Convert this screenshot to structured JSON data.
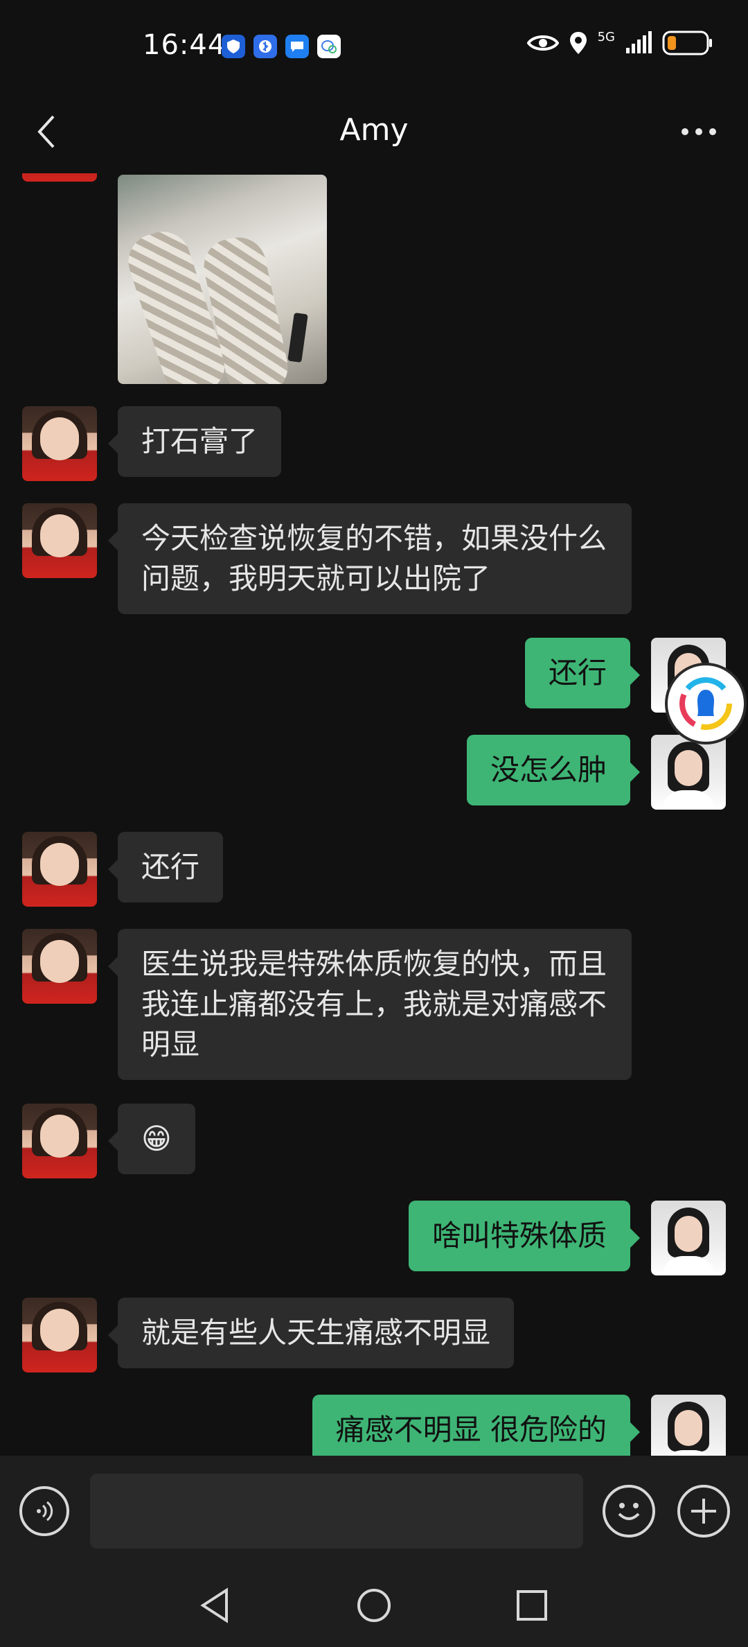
{
  "status_bar": {
    "time": "16:44",
    "network": "5G",
    "icons": [
      "shield-app-icon",
      "bluetooth-app-icon",
      "message-app-icon",
      "chat-app-icon",
      "eye-icon",
      "location-icon",
      "signal-icon",
      "battery-icon"
    ]
  },
  "nav": {
    "title": "Amy",
    "back_icon": "chevron-left-icon",
    "more_icon": "more-dots-icon"
  },
  "messages": [
    {
      "side": "in",
      "type": "image",
      "alt": ""
    },
    {
      "side": "in",
      "type": "text",
      "text": "打石膏了"
    },
    {
      "side": "in",
      "type": "text",
      "text": "今天检查说恢复的不错，如果没什么问题，我明天就可以出院了"
    },
    {
      "side": "out",
      "type": "text",
      "text": "还行"
    },
    {
      "side": "out",
      "type": "text",
      "text": "没怎么肿"
    },
    {
      "side": "in",
      "type": "text",
      "text": "还行"
    },
    {
      "side": "in",
      "type": "text",
      "text": "医生说我是特殊体质恢复的快，而且我连止痛都没有上，我就是对痛感不明显"
    },
    {
      "side": "in",
      "type": "text",
      "text": "😁"
    },
    {
      "side": "out",
      "type": "text",
      "text": "啥叫特殊体质"
    },
    {
      "side": "in",
      "type": "text",
      "text": "就是有些人天生痛感不明显"
    },
    {
      "side": "out",
      "type": "text",
      "text": "痛感不明显 很危险的"
    }
  ],
  "input": {
    "placeholder": "",
    "voice_icon": "voice-icon",
    "emoji_icon": "emoji-icon",
    "plus_icon": "plus-icon"
  },
  "colors": {
    "background": "#111111",
    "incoming_bubble": "#2c2c2c",
    "outgoing_bubble": "#3eb575"
  }
}
